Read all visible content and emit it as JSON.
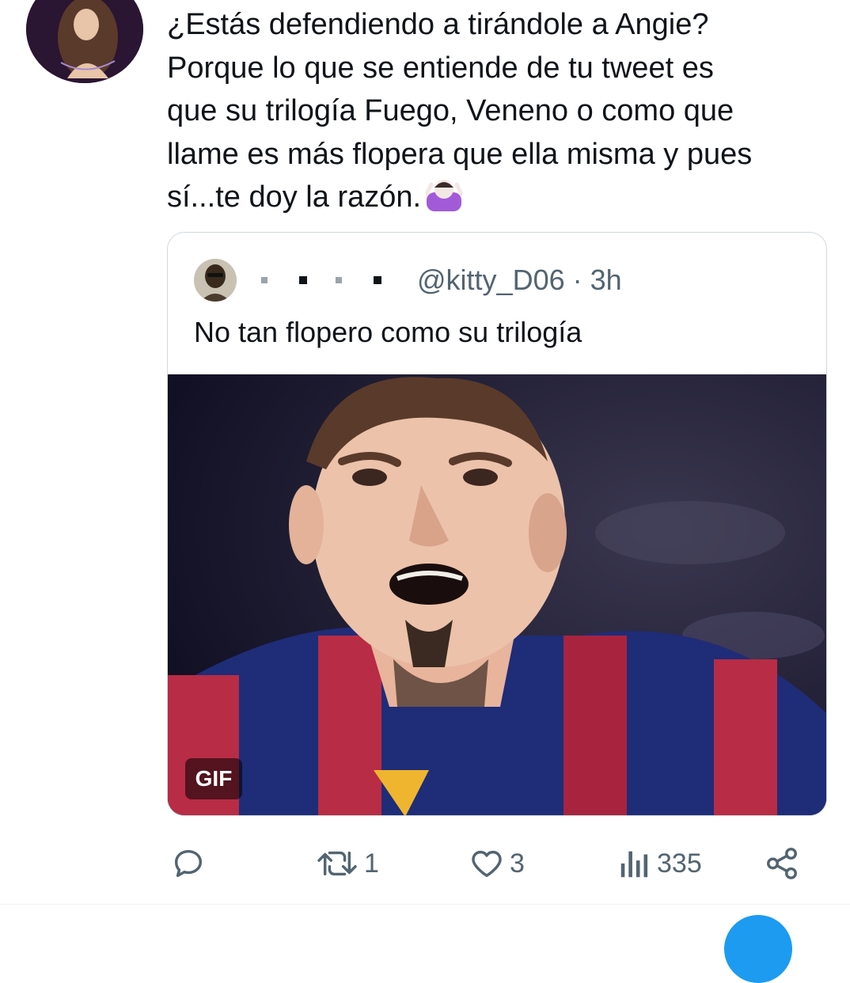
{
  "tweet": {
    "text": "¿Estás defendiendo a tirándole a Angie?\nPorque lo que se entiende de tu tweet es\nque su trilogía Fuego, Veneno o como que\nllame es más flopera que ella misma y pues\nsí...te doy la razón.",
    "emoji": "person-shrugging-emoji"
  },
  "quoted": {
    "handle": "@kitty_D06 · 3h",
    "text": "No tan flopero como su trilogía",
    "media_badge": "GIF"
  },
  "actions": {
    "reply_count": "",
    "retweet_count": "1",
    "like_count": "3",
    "views_count": "335"
  },
  "colors": {
    "text": "#0f1419",
    "secondary": "#536471",
    "border": "#cfd9de",
    "accent": "#1d9bf0"
  }
}
